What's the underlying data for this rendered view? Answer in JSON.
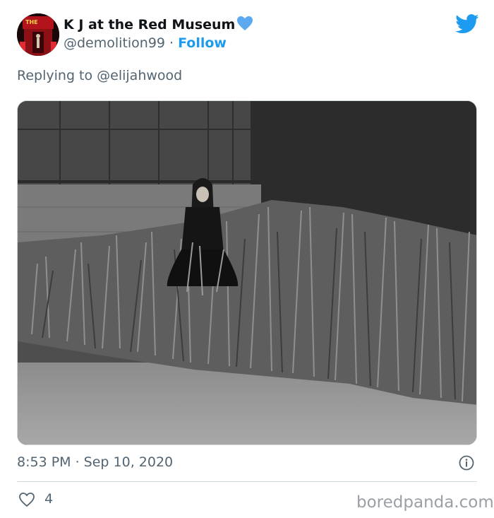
{
  "tweet": {
    "display_name": "K J at the Red Museum",
    "handle": "@demolition99",
    "separator": "·",
    "follow_label": "Follow",
    "replying_to": "Replying to @elijahwood",
    "timestamp": "8:53 PM · Sep 10, 2020",
    "like_count": "4"
  },
  "avatar": {
    "sign_text": "THE"
  },
  "watermark": "boredpanda.com",
  "colors": {
    "accent": "#1d9bf0",
    "secondary_text": "#536471",
    "heart_badge": "#5da9f0"
  },
  "icons": {
    "verified_badge": "blue-heart-icon",
    "platform": "twitter-bird-icon",
    "info": "info-circle-icon",
    "like": "heart-outline-icon"
  }
}
